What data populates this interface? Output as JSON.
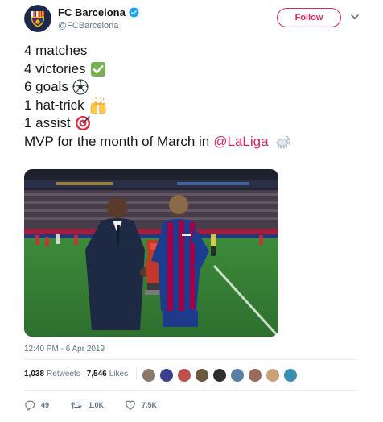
{
  "account": {
    "name": "FC Barcelona",
    "handle": "@FCBarcelona",
    "follow_label": "Follow",
    "icons": {
      "verified": "verified-badge-icon",
      "menu": "chevron-down-icon",
      "avatar": "fc-barcelona-crest-logo"
    },
    "colors": {
      "verified": "#1da1f2",
      "follow_accent": "#e0245e"
    }
  },
  "tweet": {
    "lines": [
      {
        "text": "4 matches"
      },
      {
        "text": "4 victories",
        "emoji": "check-mark-button-icon"
      },
      {
        "text": "6 goals",
        "emoji": "soccer-ball-icon"
      },
      {
        "text": "1 hat-trick",
        "emoji": "raising-hands-icon"
      },
      {
        "text": "1 assist",
        "emoji": "direct-hit-target-icon"
      },
      {
        "text": "MVP for the month of March in",
        "mention": "@LaLiga",
        "emoji": "goat-icon"
      }
    ],
    "mention_color": "#e0245e",
    "image": "photo-two-men-with-trophy-on-football-pitch",
    "timestamp": "12:40 PM - 6 Apr 2019"
  },
  "stats": {
    "retweets_count": "1,038",
    "retweets_label": "Retweets",
    "likes_count": "7,546",
    "likes_label": "Likes",
    "liker_avatars": 9
  },
  "actions": {
    "reply_count": "49",
    "retweet_count": "1.0K",
    "like_count": "7.5K",
    "icons": [
      "reply-icon",
      "retweet-icon",
      "like-heart-icon"
    ]
  }
}
